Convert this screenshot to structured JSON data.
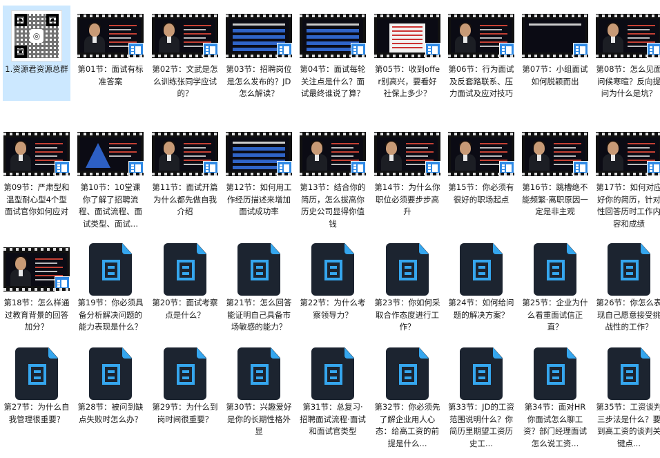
{
  "files": [
    {
      "label": "1.资源君资源总群",
      "icon": "qr-code-icon",
      "selected": true
    },
    {
      "label": "第01节：面试有标准答案",
      "icon": "video-thumbnail-icon",
      "thumb": "person"
    },
    {
      "label": "第02节：文武是怎么训练张同学应试的？",
      "icon": "video-thumbnail-icon",
      "thumb": "person"
    },
    {
      "label": "第03节：招聘岗位是怎么发布的？JD怎么解读？",
      "icon": "video-thumbnail-icon",
      "thumb": "slide"
    },
    {
      "label": "第04节：面试每轮关注点是什么？面试最终谁说了算？",
      "icon": "video-thumbnail-icon",
      "thumb": "slide"
    },
    {
      "label": "第05节：收到offer别高兴，要看好社保上多少？",
      "icon": "video-thumbnail-icon",
      "thumb": "document"
    },
    {
      "label": "第06节：行为面试及反套路联系、压力面试及应对技巧",
      "icon": "video-thumbnail-icon",
      "thumb": "person"
    },
    {
      "label": "第07节：小组面试如何脱颖而出",
      "icon": "video-thumbnail-icon",
      "thumb": "dark"
    },
    {
      "label": "第08节：怎么见面问候寒暄？反向提问为什么是坑？",
      "icon": "video-thumbnail-icon",
      "thumb": "person"
    },
    {
      "label": "第09节：严肃型和温型耐心型4个型面试官你如何应对",
      "icon": "video-thumbnail-icon",
      "thumb": "person"
    },
    {
      "label": "第10节：10堂课你了解了招聘流程、面试流程、面试类型、面试...",
      "icon": "video-thumbnail-icon",
      "thumb": "triangle"
    },
    {
      "label": "第11节：面试开篇为什么都先做自我介绍",
      "icon": "video-thumbnail-icon",
      "thumb": "person"
    },
    {
      "label": "第12节：如何用工作经历描述来增加面试成功率",
      "icon": "video-thumbnail-icon",
      "thumb": "bars"
    },
    {
      "label": "第13节：结合你的简历，怎么拔高你历史公司显得你值钱",
      "icon": "video-thumbnail-icon",
      "thumb": "person"
    },
    {
      "label": "第14节：为什么你职位必须要步步高升",
      "icon": "video-thumbnail-icon",
      "thumb": "person"
    },
    {
      "label": "第15节：你必须有很好的职场起点",
      "icon": "video-thumbnail-icon",
      "thumb": "person"
    },
    {
      "label": "第16节：跳槽绝不能频繁·离职原因一定是非主观",
      "icon": "video-thumbnail-icon",
      "thumb": "person"
    },
    {
      "label": "第17节：如何对应好你的简历，针对性回答历时工作内容和成绩",
      "icon": "video-thumbnail-icon",
      "thumb": "person"
    },
    {
      "label": "第18节：怎么样通过教育背景的回答加分？",
      "icon": "video-thumbnail-icon",
      "thumb": "person"
    },
    {
      "label": "第19节：你必须具备分析解决问题的能力表现是什么？",
      "icon": "video-file-icon"
    },
    {
      "label": "第20节：面试考察点是什么？",
      "icon": "video-file-icon"
    },
    {
      "label": "第21节：怎么回答能证明自己具备市场敏感的能力？",
      "icon": "video-file-icon"
    },
    {
      "label": "第22节：为什么考察领导力？",
      "icon": "video-file-icon"
    },
    {
      "label": "第23节：你如何采取合作态度进行工作？",
      "icon": "video-file-icon"
    },
    {
      "label": "第24节：如何给问题的解决方案？",
      "icon": "video-file-icon"
    },
    {
      "label": "第25节：企业为什么看重面试信正直？",
      "icon": "video-file-icon"
    },
    {
      "label": "第26节：你怎么表现自己愿意接受挑战性的工作？",
      "icon": "video-file-icon"
    },
    {
      "label": "第27节：为什么自我管理很重要？",
      "icon": "video-file-icon"
    },
    {
      "label": "第28节：被问到缺点失败时怎么办？",
      "icon": "video-file-icon"
    },
    {
      "label": "第29节：为什么到岗时间很重要？",
      "icon": "video-file-icon"
    },
    {
      "label": "第30节：兴趣爱好是你的长期性格外显",
      "icon": "video-file-icon"
    },
    {
      "label": "第31节：总复习·招聘面试流程·面试和面试官类型",
      "icon": "video-file-icon"
    },
    {
      "label": "第32节：你必须先了解企业用人心态：给高工资的前提是什么...",
      "icon": "video-file-icon"
    },
    {
      "label": "第33节：JD的工资范围说明什么？你简历里期望工资历史工...",
      "icon": "video-file-icon"
    },
    {
      "label": "第34节：面对HR你面试怎么聊工资？部门经理面试怎么说工资...",
      "icon": "video-file-icon"
    },
    {
      "label": "第35节：工资谈判三步法是什么？要到高工资的谈判关键点...",
      "icon": "video-file-icon"
    }
  ],
  "colors": {
    "selection": "#cce8ff",
    "accent": "#35a6ee",
    "file_bg": "#1c2430"
  }
}
